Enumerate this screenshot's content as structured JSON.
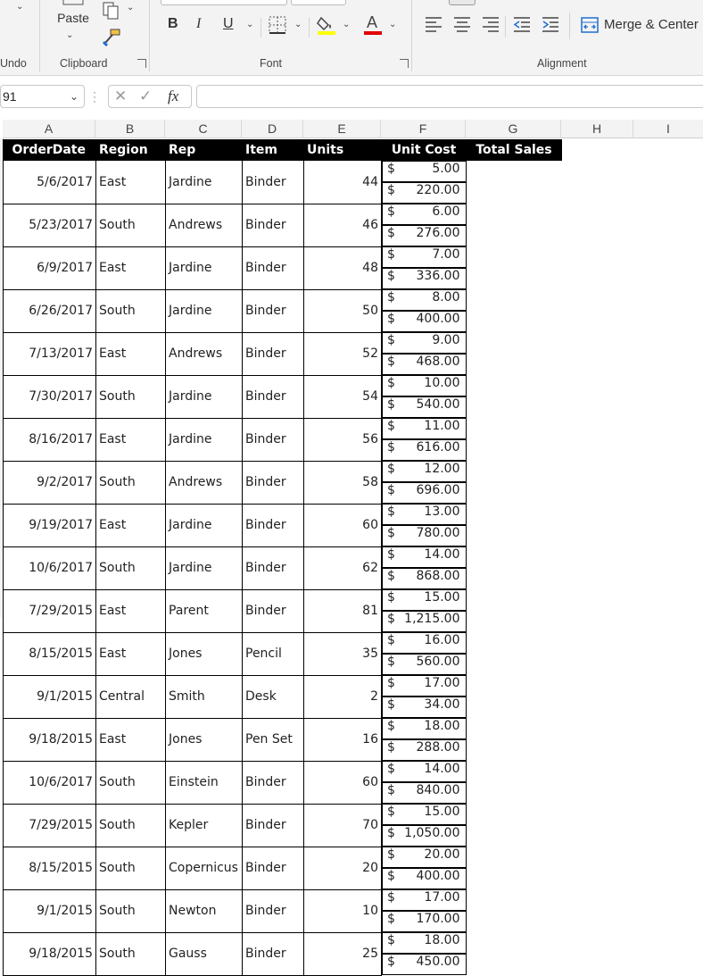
{
  "ribbon": {
    "undo_label": "Undo",
    "paste_label": "Paste",
    "groups": {
      "clipboard": "Clipboard",
      "font": "Font",
      "alignment": "Alignment"
    },
    "merge_center_label": "Merge & Center",
    "colors": {
      "highlight": "#ffff00",
      "font_color": "#e00000"
    }
  },
  "formula_bar": {
    "name_box": "91",
    "fx_label": "fx",
    "formula": ""
  },
  "column_letters": [
    "A",
    "B",
    "C",
    "D",
    "E",
    "F",
    "G",
    "H",
    "I"
  ],
  "table": {
    "headers": [
      "OrderDate",
      "Region",
      "Rep",
      "Item",
      "Units",
      "Unit Cost",
      "Total Sales"
    ],
    "currency_symbol": "$",
    "rows": [
      {
        "date": "5/6/2017",
        "region": "East",
        "rep": "Jardine",
        "item": "Binder",
        "units": "44",
        "cost": "5.00",
        "total": "220.00"
      },
      {
        "date": "5/23/2017",
        "region": "South",
        "rep": "Andrews",
        "item": "Binder",
        "units": "46",
        "cost": "6.00",
        "total": "276.00"
      },
      {
        "date": "6/9/2017",
        "region": "East",
        "rep": "Jardine",
        "item": "Binder",
        "units": "48",
        "cost": "7.00",
        "total": "336.00"
      },
      {
        "date": "6/26/2017",
        "region": "South",
        "rep": "Jardine",
        "item": "Binder",
        "units": "50",
        "cost": "8.00",
        "total": "400.00"
      },
      {
        "date": "7/13/2017",
        "region": "East",
        "rep": "Andrews",
        "item": "Binder",
        "units": "52",
        "cost": "9.00",
        "total": "468.00"
      },
      {
        "date": "7/30/2017",
        "region": "South",
        "rep": "Jardine",
        "item": "Binder",
        "units": "54",
        "cost": "10.00",
        "total": "540.00"
      },
      {
        "date": "8/16/2017",
        "region": "East",
        "rep": "Jardine",
        "item": "Binder",
        "units": "56",
        "cost": "11.00",
        "total": "616.00"
      },
      {
        "date": "9/2/2017",
        "region": "South",
        "rep": "Andrews",
        "item": "Binder",
        "units": "58",
        "cost": "12.00",
        "total": "696.00"
      },
      {
        "date": "9/19/2017",
        "region": "East",
        "rep": "Jardine",
        "item": "Binder",
        "units": "60",
        "cost": "13.00",
        "total": "780.00"
      },
      {
        "date": "10/6/2017",
        "region": "South",
        "rep": "Jardine",
        "item": "Binder",
        "units": "62",
        "cost": "14.00",
        "total": "868.00"
      },
      {
        "date": "7/29/2015",
        "region": "East",
        "rep": "Parent",
        "item": "Binder",
        "units": "81",
        "cost": "15.00",
        "total": "1,215.00"
      },
      {
        "date": "8/15/2015",
        "region": "East",
        "rep": "Jones",
        "item": "Pencil",
        "units": "35",
        "cost": "16.00",
        "total": "560.00"
      },
      {
        "date": "9/1/2015",
        "region": "Central",
        "rep": "Smith",
        "item": "Desk",
        "units": "2",
        "cost": "17.00",
        "total": "34.00"
      },
      {
        "date": "9/18/2015",
        "region": "East",
        "rep": "Jones",
        "item": "Pen Set",
        "units": "16",
        "cost": "18.00",
        "total": "288.00"
      },
      {
        "date": "10/6/2017",
        "region": "South",
        "rep": "Einstein",
        "item": "Binder",
        "units": "60",
        "cost": "14.00",
        "total": "840.00"
      },
      {
        "date": "7/29/2015",
        "region": "South",
        "rep": "Kepler",
        "item": "Binder",
        "units": "70",
        "cost": "15.00",
        "total": "1,050.00"
      },
      {
        "date": "8/15/2015",
        "region": "South",
        "rep": "Copernicus",
        "item": "Binder",
        "units": "20",
        "cost": "20.00",
        "total": "400.00"
      },
      {
        "date": "9/1/2015",
        "region": "South",
        "rep": "Newton",
        "item": "Binder",
        "units": "10",
        "cost": "17.00",
        "total": "170.00"
      },
      {
        "date": "9/18/2015",
        "region": "South",
        "rep": "Gauss",
        "item": "Binder",
        "units": "25",
        "cost": "18.00",
        "total": "450.00"
      }
    ]
  }
}
